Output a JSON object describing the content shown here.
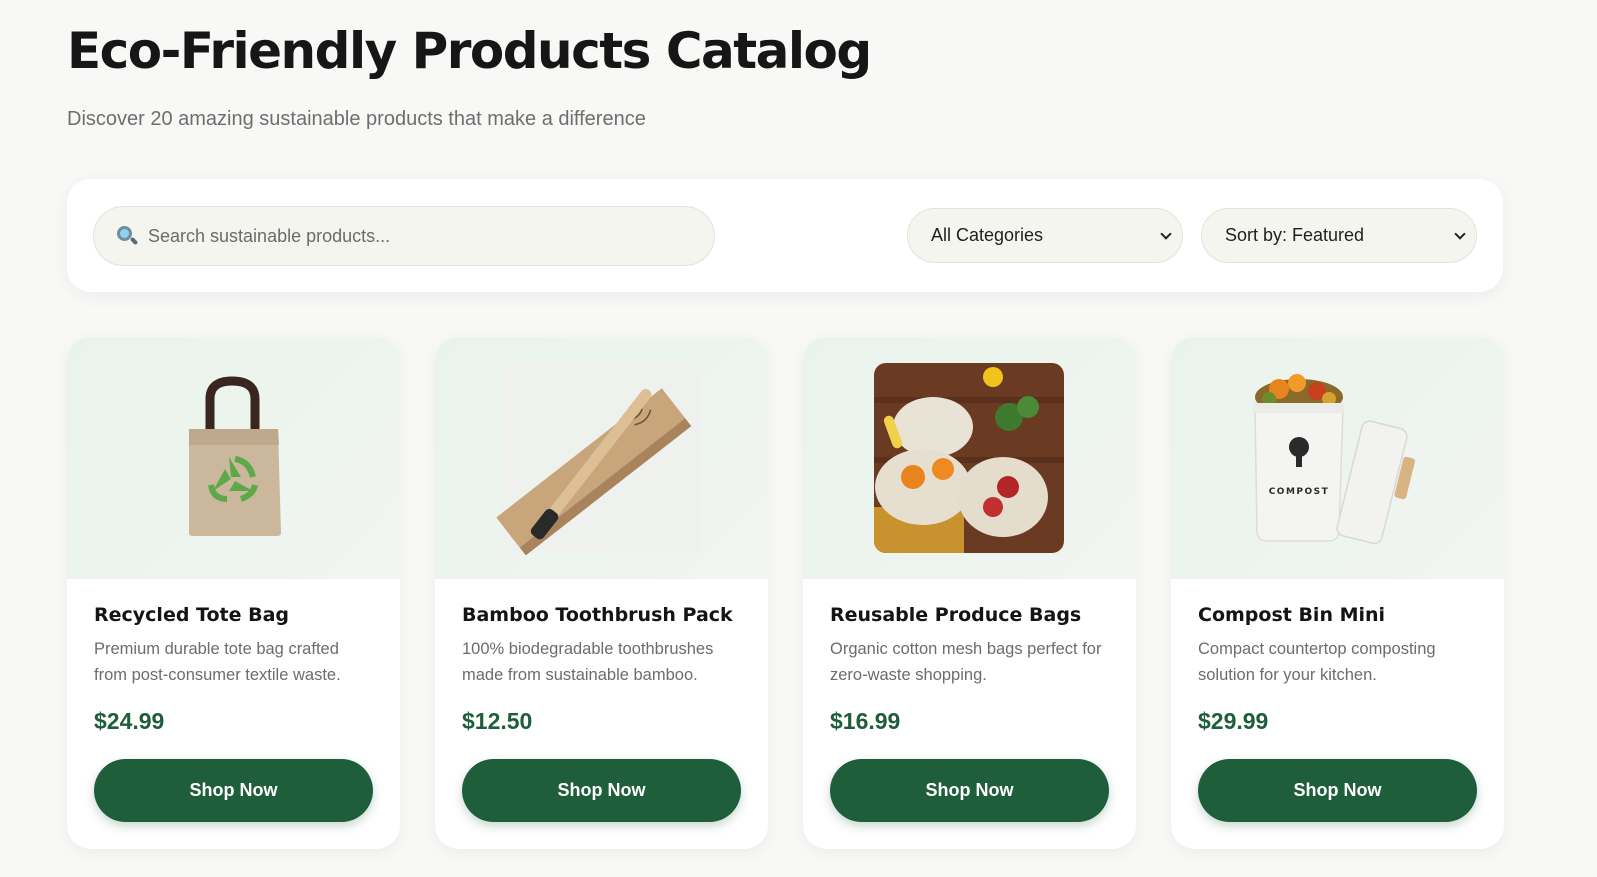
{
  "header": {
    "title": "Eco-Friendly Products Catalog",
    "subtitle": "Discover 20 amazing sustainable products that make a difference"
  },
  "toolbar": {
    "search_placeholder": "Search sustainable products...",
    "search_icon": "search-icon",
    "category_selected": "All Categories",
    "sort_selected": "Sort by: Featured"
  },
  "colors": {
    "accent": "#1e5e3b",
    "price": "#1f5e3a",
    "background": "#f8f8f6",
    "card_media_bg": "#eaf3ec"
  },
  "products": [
    {
      "name": "Recycled Tote Bag",
      "description": "Premium durable tote bag crafted from post-consumer textile waste.",
      "price": "$24.99",
      "button": "Shop Now",
      "image": "tote-bag-image"
    },
    {
      "name": "Bamboo Toothbrush Pack",
      "description": "100% biodegradable toothbrushes made from sustainable bamboo.",
      "price": "$12.50",
      "button": "Shop Now",
      "image": "bamboo-toothbrush-image"
    },
    {
      "name": "Reusable Produce Bags",
      "description": "Organic cotton mesh bags perfect for zero-waste shopping.",
      "price": "$16.99",
      "button": "Shop Now",
      "image": "produce-bags-image"
    },
    {
      "name": "Compost Bin Mini",
      "description": "Compact countertop composting solution for your kitchen.",
      "price": "$29.99",
      "button": "Shop Now",
      "image": "compost-bin-image",
      "image_label": "COMPOST"
    }
  ]
}
